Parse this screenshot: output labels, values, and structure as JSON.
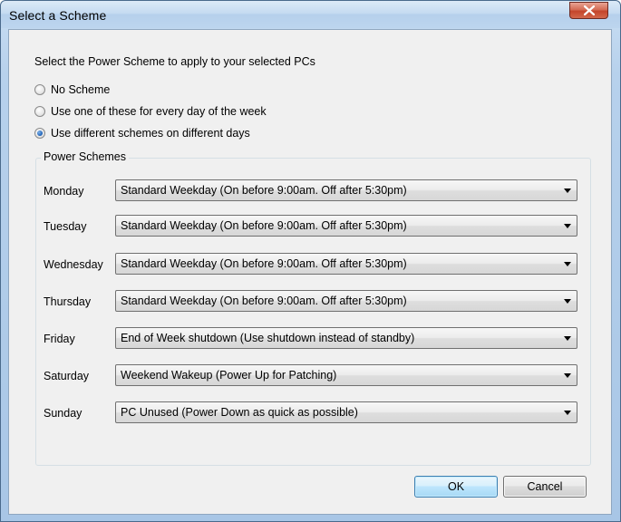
{
  "window": {
    "title": "Select a Scheme",
    "close_icon": "close-x-icon"
  },
  "instruction": "Select the Power Scheme to apply to your selected PCs",
  "scheme_options": [
    {
      "label": "No Scheme",
      "checked": false
    },
    {
      "label": "Use one of these for every day of the week",
      "checked": false
    },
    {
      "label": "Use different schemes on different days",
      "checked": true
    }
  ],
  "power_schemes": {
    "group_title": "Power Schemes",
    "days": [
      {
        "day": "Monday",
        "scheme": "Standard Weekday (On before 9:00am. Off after 5:30pm)"
      },
      {
        "day": "Tuesday",
        "scheme": "Standard Weekday (On before 9:00am. Off after 5:30pm)"
      },
      {
        "day": "Wednesday",
        "scheme": "Standard Weekday (On before 9:00am. Off after 5:30pm)"
      },
      {
        "day": "Thursday",
        "scheme": "Standard Weekday (On before 9:00am. Off after 5:30pm)"
      },
      {
        "day": "Friday",
        "scheme": "End of Week shutdown (Use shutdown instead of standby)"
      },
      {
        "day": "Saturday",
        "scheme": "Weekend Wakeup (Power Up for Patching)"
      },
      {
        "day": "Sunday",
        "scheme": "PC Unused (Power Down as quick as possible)"
      }
    ]
  },
  "buttons": {
    "ok": "OK",
    "cancel": "Cancel"
  },
  "colors": {
    "accent": "#1b5fb5",
    "window_frame": "#a8c6e6",
    "close_button": "#c4452b"
  }
}
